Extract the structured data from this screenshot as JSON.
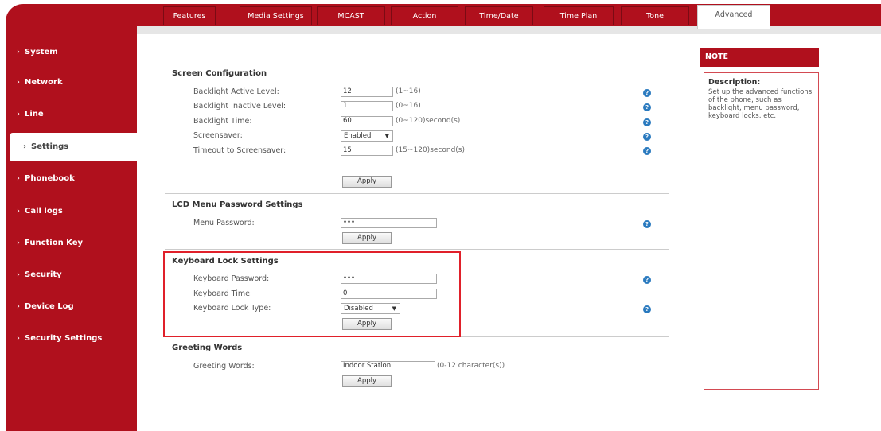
{
  "tabs": [
    {
      "label": "Features"
    },
    {
      "label": "Media Settings"
    },
    {
      "label": "MCAST"
    },
    {
      "label": "Action"
    },
    {
      "label": "Time/Date"
    },
    {
      "label": "Time Plan"
    },
    {
      "label": "Tone"
    },
    {
      "label": "Advanced"
    }
  ],
  "sidebar": {
    "items": [
      {
        "label": "System"
      },
      {
        "label": "Network"
      },
      {
        "label": "Line"
      },
      {
        "label": "Settings"
      },
      {
        "label": "Phonebook"
      },
      {
        "label": "Call logs"
      },
      {
        "label": "Function Key"
      },
      {
        "label": "Security"
      },
      {
        "label": "Device Log"
      },
      {
        "label": "Security Settings"
      }
    ],
    "chevron": "›"
  },
  "screen": {
    "title": "Screen Configuration",
    "rows": [
      {
        "label": "Backlight Active Level:",
        "value": "12",
        "hint": "(1~16)"
      },
      {
        "label": "Backlight Inactive Level:",
        "value": "1",
        "hint": "(0~16)"
      },
      {
        "label": "Backlight Time:",
        "value": "60",
        "hint": "(0~120)second(s)"
      },
      {
        "label": "Screensaver:",
        "value": "Enabled",
        "hint": ""
      },
      {
        "label": "Timeout to Screensaver:",
        "value": "15",
        "hint": "(15~120)second(s)"
      }
    ],
    "apply": "Apply"
  },
  "lcd": {
    "title": "LCD Menu Password Settings",
    "label": "Menu Password:",
    "value": "•••",
    "apply": "Apply"
  },
  "keyboard": {
    "title": "Keyboard Lock Settings",
    "password_label": "Keyboard Password:",
    "password_value": "•••",
    "time_label": "Keyboard Time:",
    "time_value": "0",
    "type_label": "Keyboard Lock Type:",
    "type_value": "Disabled",
    "apply": "Apply"
  },
  "greeting": {
    "title": "Greeting Words",
    "label": "Greeting Words:",
    "value": "Indoor Station",
    "hint": "(0-12 character(s))",
    "apply": "Apply"
  },
  "note": {
    "header": "NOTE",
    "title": "Description:",
    "text": "Set up the advanced functions of the phone, such as backlight, menu password, keyboard locks, etc."
  },
  "help_glyph": "?",
  "select_arrow": "▼",
  "colors": {
    "accent": "#b0101d",
    "highlight": "#e0202a",
    "help": "#2a7abf"
  }
}
